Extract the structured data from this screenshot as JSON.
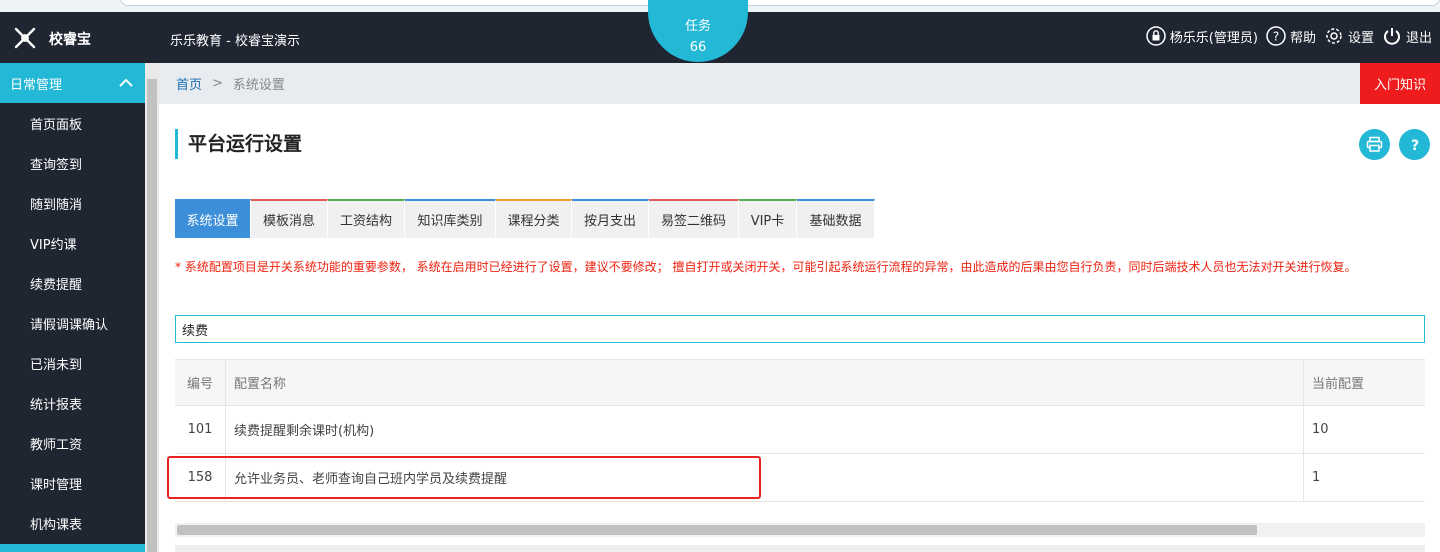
{
  "header": {
    "logo_text": "校睿宝",
    "org_title": "乐乐教育 - 校睿宝演示",
    "task_label": "任务",
    "task_count": "66",
    "user": "杨乐乐(管理员)",
    "help": "帮助",
    "settings": "设置",
    "logout": "退出"
  },
  "sidebar": {
    "section": "日常管理",
    "items": [
      "首页面板",
      "查询签到",
      "随到随消",
      "VIP约课",
      "续费提醒",
      "请假调课确认",
      "已消未到",
      "统计报表",
      "教师工资",
      "课时管理",
      "机构课表"
    ]
  },
  "breadcrumb": {
    "home": "首页",
    "sep": ">",
    "current": "系统设置"
  },
  "intro_button": "入门知识",
  "page_title": "平台运行设置",
  "icons": {
    "print": "print-icon",
    "help": "question-icon"
  },
  "tabs": [
    {
      "label": "系统设置",
      "color": "#3d8fd9"
    },
    {
      "label": "模板消息",
      "color": "#e05a5a"
    },
    {
      "label": "工资结构",
      "color": "#52b052"
    },
    {
      "label": "知识库类别",
      "color": "#3d8fd9"
    },
    {
      "label": "课程分类",
      "color": "#f0a030"
    },
    {
      "label": "按月支出",
      "color": "#3d8fd9"
    },
    {
      "label": "易签二维码",
      "color": "#e05a5a"
    },
    {
      "label": "VIP卡",
      "color": "#52b052"
    },
    {
      "label": "基础数据",
      "color": "#3d8fd9"
    }
  ],
  "warning": "* 系统配置项目是开关系统功能的重要参数， 系统在启用时已经进行了设置，建议不要修改； 擅自打开或关闭开关，可能引起系统运行流程的异常，由此造成的后果由您自行负责，同时后端技术人员也无法对开关进行恢复。",
  "search": {
    "value": "续费"
  },
  "table": {
    "headers": [
      "编号",
      "配置名称",
      "当前配置"
    ],
    "rows": [
      [
        "101",
        "续费提醒剩余课时(机构)",
        "10"
      ],
      [
        "158",
        "允许业务员、老师查询自己班内学员及续费提醒",
        "1"
      ]
    ]
  },
  "colors": {
    "accent": "#22b8d6",
    "header_bg": "#1f2531",
    "alert": "#ee1c1c"
  }
}
